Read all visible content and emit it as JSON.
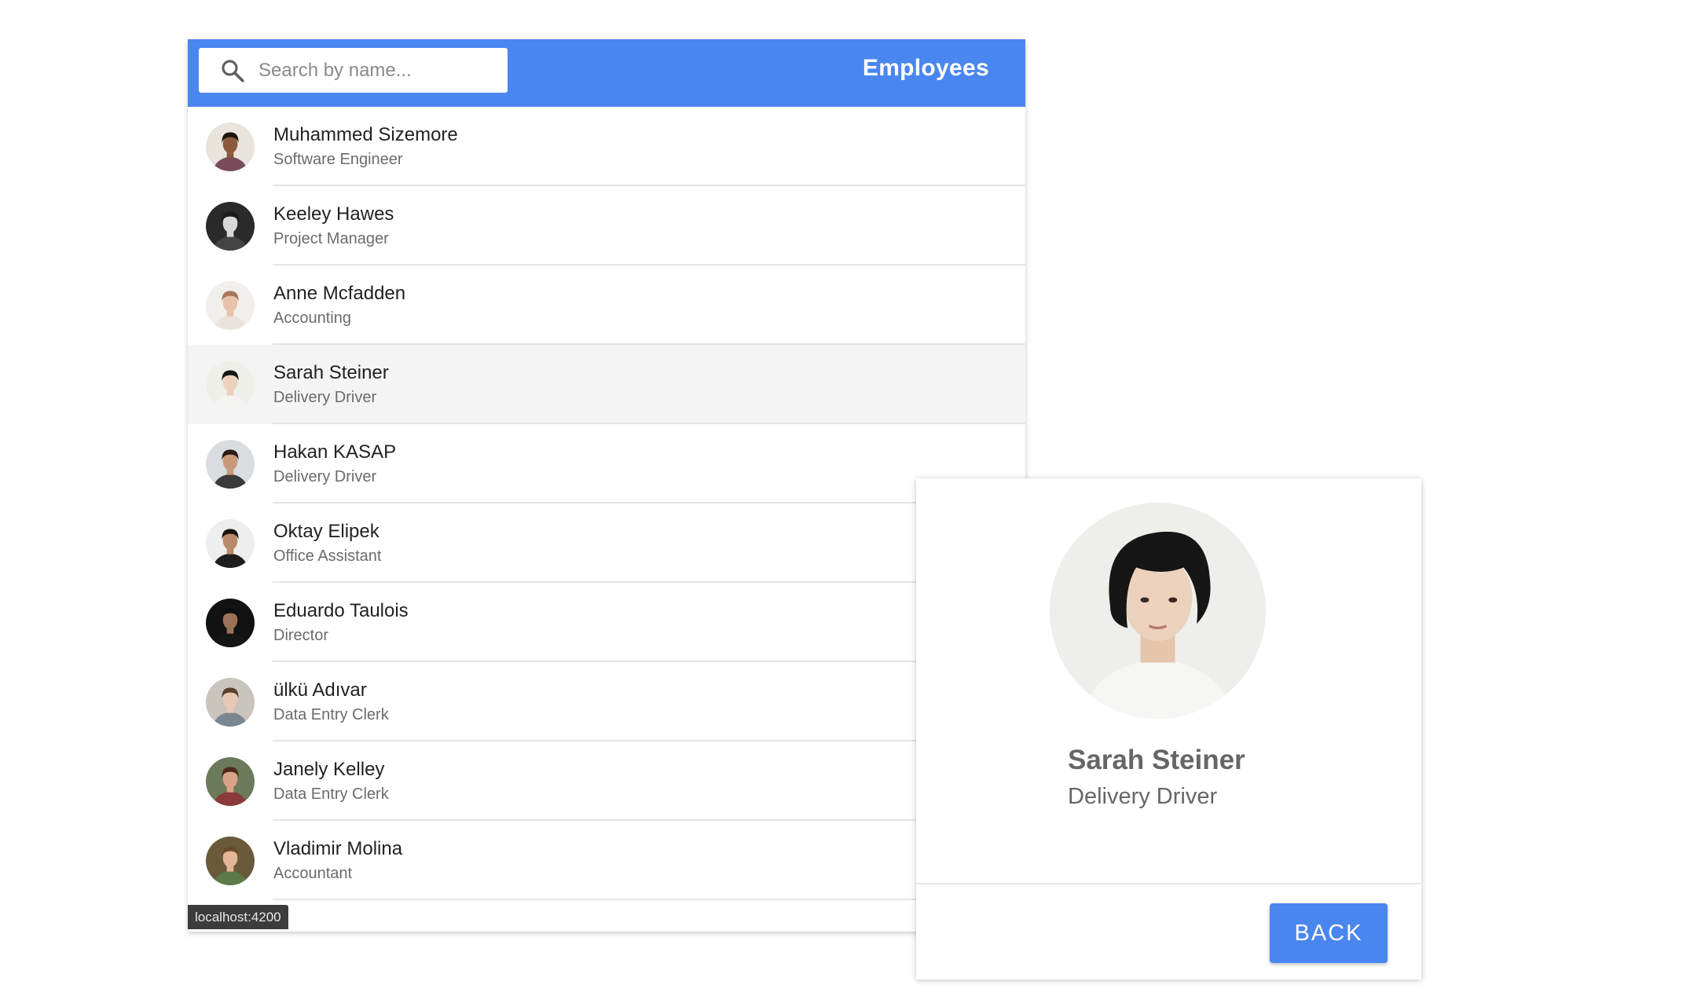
{
  "toolbar": {
    "title": "Employees",
    "search_placeholder": "Search by name...",
    "search_value": ""
  },
  "employees": [
    {
      "name": "Muhammed Sizemore",
      "title": "Software Engineer",
      "avatar_bg": "#e9e4dc",
      "skin": "#8a5a3c",
      "hair": "#1d1410",
      "shirt": "#7a4a5a"
    },
    {
      "name": "Keeley Hawes",
      "title": "Project Manager",
      "avatar_bg": "#2a2a2a",
      "skin": "#d8d8d8",
      "hair": "#1a1a1a",
      "shirt": "#444444"
    },
    {
      "name": "Anne Mcfadden",
      "title": "Accounting",
      "avatar_bg": "#f1efec",
      "skin": "#e8c2a8",
      "hair": "#a8785a",
      "shirt": "#e9e4de"
    },
    {
      "name": "Sarah Steiner",
      "title": "Delivery Driver",
      "avatar_bg": "#efefea",
      "skin": "#ecd2bd",
      "hair": "#151515",
      "shirt": "#f3f3f1"
    },
    {
      "name": "Hakan KASAP",
      "title": "Delivery Driver",
      "avatar_bg": "#d9dde0",
      "skin": "#c79a7a",
      "hair": "#2a1a12",
      "shirt": "#3b3b3b"
    },
    {
      "name": "Oktay Elipek",
      "title": "Office Assistant",
      "avatar_bg": "#eeeeee",
      "skin": "#b98a6a",
      "hair": "#1a1410",
      "shirt": "#1e1e1e"
    },
    {
      "name": "Eduardo Taulois",
      "title": "Director",
      "avatar_bg": "#121212",
      "skin": "#9a7258",
      "hair": "#0d0d0d",
      "shirt": "#161616"
    },
    {
      "name": "ülkü Adıvar",
      "title": "Data Entry Clerk",
      "avatar_bg": "#c9c4bd",
      "skin": "#e6c8b4",
      "hair": "#5a4030",
      "shirt": "#7a8790"
    },
    {
      "name": "Janely Kelley",
      "title": "Data Entry Clerk",
      "avatar_bg": "#6b7a5a",
      "skin": "#d8a488",
      "hair": "#4a2a1c",
      "shirt": "#8a3a3a"
    },
    {
      "name": "Vladimir Molina",
      "title": "Accountant",
      "avatar_bg": "#6a5a3c",
      "skin": "#e2b696",
      "hair": "#6a4a2c",
      "shirt": "#5a7a4a"
    }
  ],
  "selected_index": 3,
  "status_bar": {
    "url": "localhost:4200"
  },
  "detail": {
    "name": "Sarah Steiner",
    "title": "Delivery Driver",
    "back_label": "BACK"
  },
  "colors": {
    "primary": "#4a86f0",
    "selected_row": "#f4f4f4"
  }
}
